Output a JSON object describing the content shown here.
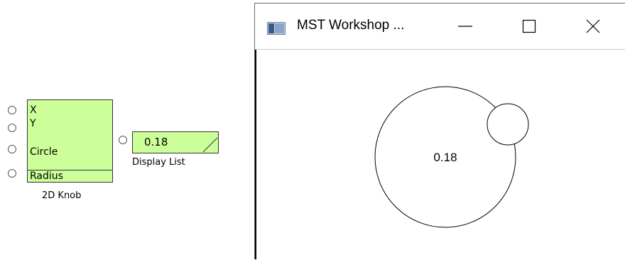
{
  "knob_block": {
    "ports": [
      "X",
      "Y",
      "Circle",
      "Radius"
    ],
    "caption": "2D Knob",
    "fill_color": "#ccff99"
  },
  "display_block": {
    "value": "0.18",
    "caption": "Display List",
    "fill_color": "#ccff99"
  },
  "window": {
    "title": "MST Workshop ...",
    "app_icon": "app-icon",
    "minimize_icon": "minimize-icon",
    "maximize_icon": "maximize-icon",
    "close_icon": "close-icon",
    "knob_value_label": "0.18",
    "knob_value": 0.18
  }
}
